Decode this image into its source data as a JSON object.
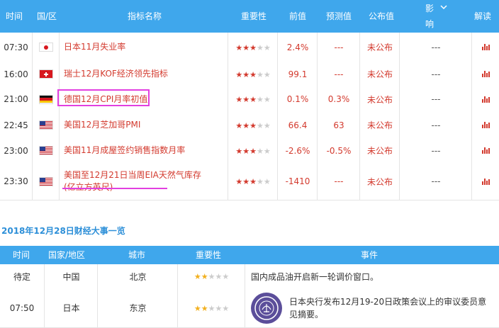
{
  "header": {
    "time": "时间",
    "country": "国/区",
    "indicator": "指标名称",
    "importance": "重要性",
    "previous": "前值",
    "forecast": "预测值",
    "actual": "公布值",
    "impact_top": "影",
    "impact_bottom": "响",
    "interpret": "解读"
  },
  "rows": [
    {
      "time": "07:30",
      "flag": "japan-flag-icon",
      "indicator": "日本11月失业率",
      "stars": 3,
      "previous": "2.4%",
      "forecast": "---",
      "actual": "未公布",
      "impact": "---"
    },
    {
      "time": "16:00",
      "flag": "switzerland-flag-icon",
      "indicator": "瑞士12月KOF经济领先指标",
      "stars": 3,
      "previous": "99.1",
      "forecast": "---",
      "actual": "未公布",
      "impact": "---"
    },
    {
      "time": "21:00",
      "flag": "germany-flag-icon",
      "indicator": "德国12月CPI月率初值",
      "stars": 3,
      "previous": "0.1%",
      "forecast": "0.3%",
      "actual": "未公布",
      "impact": "---"
    },
    {
      "time": "22:45",
      "flag": "usa-flag-icon",
      "indicator": "美国12月芝加哥PMI",
      "stars": 3,
      "previous": "66.4",
      "forecast": "63",
      "actual": "未公布",
      "impact": "---"
    },
    {
      "time": "23:00",
      "flag": "usa-flag-icon",
      "indicator": "美国11月成屋签约销售指数月率",
      "stars": 3,
      "previous": "-2.6%",
      "forecast": "-0.5%",
      "actual": "未公布",
      "impact": "---"
    },
    {
      "time": "23:30",
      "flag": "usa-flag-icon",
      "indicator": "美国至12月21日当周EIA天然气库存(亿立方英尺)",
      "stars": 3,
      "previous": "-1410",
      "forecast": "---",
      "actual": "未公布",
      "impact": "---"
    }
  ],
  "events_section": {
    "title": "2018年12月28日财经大事一览",
    "header": {
      "time": "时间",
      "country": "国家/地区",
      "city": "城市",
      "importance": "重要性",
      "event": "事件"
    },
    "rows": [
      {
        "time": "待定",
        "country": "中国",
        "city": "北京",
        "stars": 2,
        "event": "国内成品油开启新一轮调价窗口。"
      },
      {
        "time": "07:50",
        "country": "日本",
        "city": "东京",
        "stars": 2,
        "event": "日本央行发布12月19-20日政策会议上的审议委员意见摘要。"
      }
    ]
  },
  "colors": {
    "header_bg": "#3fa7ec",
    "text_red": "#d33a2e",
    "highlight": "#e23fe0",
    "section_title": "#2d8fd8",
    "star_gold": "#f2b01e"
  }
}
